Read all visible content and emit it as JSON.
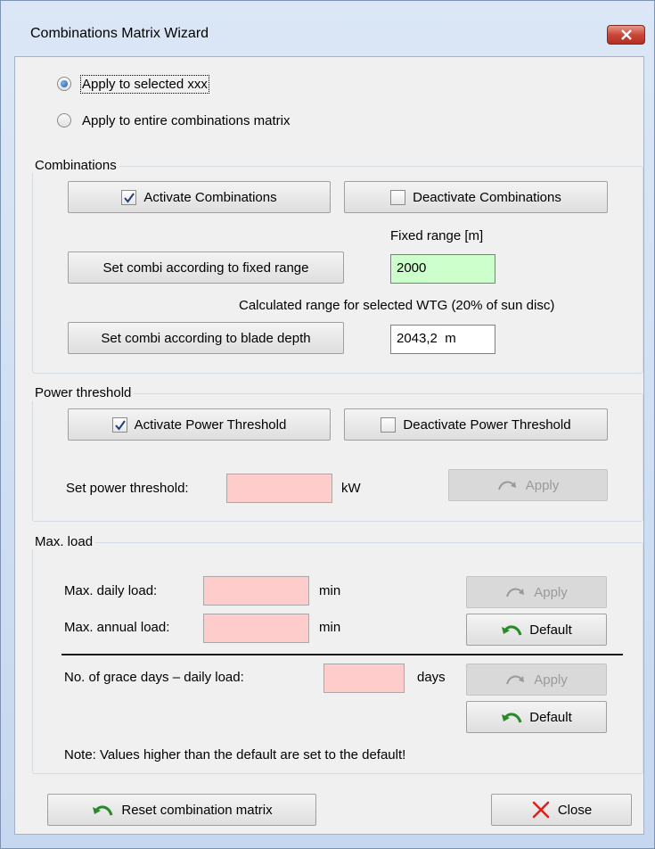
{
  "window": {
    "title": "Combinations Matrix Wizard"
  },
  "scope": {
    "apply_selected_label": "Apply to selected xxx",
    "apply_entire_label": "Apply to entire combinations matrix",
    "selected": "apply_selected"
  },
  "combinations": {
    "legend": "Combinations",
    "activate_label": "Activate Combinations",
    "activate_checked": true,
    "deactivate_label": "Deactivate Combinations",
    "deactivate_checked": false,
    "fixed_range_caption": "Fixed range [m]",
    "set_fixed_label": "Set combi according to fixed range",
    "fixed_range_value": "2000",
    "calc_caption": "Calculated range for selected WTG (20% of sun disc)",
    "set_blade_label": "Set combi according to blade depth",
    "calc_value": "2043,2  m"
  },
  "power": {
    "legend": "Power threshold",
    "activate_label": "Activate Power Threshold",
    "activate_checked": true,
    "deactivate_label": "Deactivate Power Threshold",
    "deactivate_checked": false,
    "set_label": "Set power threshold:",
    "value": "",
    "unit": "kW",
    "apply_label": "Apply"
  },
  "maxload": {
    "legend": "Max. load",
    "daily_label": "Max. daily load:",
    "daily_value": "",
    "daily_unit": "min",
    "annual_label": "Max. annual load:",
    "annual_value": "",
    "annual_unit": "min",
    "apply_label": "Apply",
    "default_label": "Default",
    "grace_label": "No. of grace days – daily load:",
    "grace_value": "",
    "grace_unit": "days",
    "grace_apply_label": "Apply",
    "grace_default_label": "Default",
    "note": "Note: Values higher than the default are set to the default!"
  },
  "footer": {
    "reset_label": "Reset combination matrix",
    "close_label": "Close"
  },
  "colors": {
    "field_ok": "#ccffcc",
    "field_invalid": "#ffcccc",
    "undo_arrow": "#2a8a2a",
    "close_x": "#e0201b"
  }
}
